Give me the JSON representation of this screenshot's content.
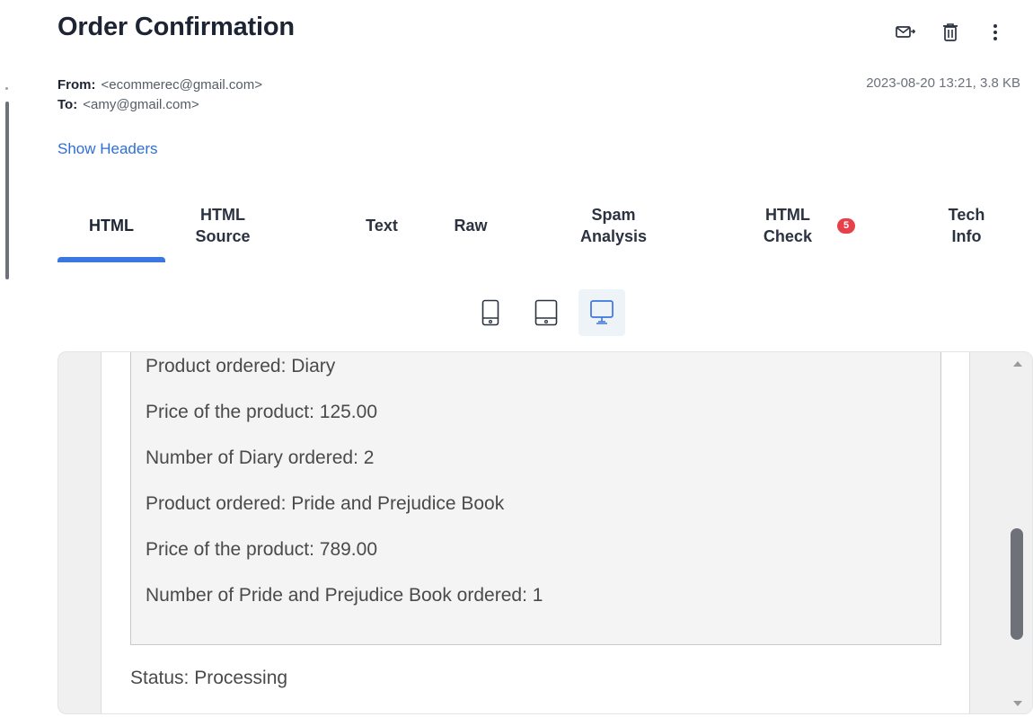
{
  "email": {
    "subject": "Order Confirmation",
    "from_label": "From:",
    "from_value": "<ecommerec@gmail.com>",
    "to_label": "To:",
    "to_value": "<amy@gmail.com>",
    "date_size": "2023-08-20 13:21, 3.8 KB",
    "show_headers": "Show Headers"
  },
  "actions": {
    "forward_icon": "envelope-forward-icon",
    "delete_icon": "trash-icon",
    "more_icon": "more-vertical-icon"
  },
  "tabs": [
    {
      "label": "HTML",
      "active": true
    },
    {
      "label_line1": "HTML",
      "label_line2": "Source"
    },
    {
      "label": "Text"
    },
    {
      "label": "Raw"
    },
    {
      "label_line1": "Spam",
      "label_line2": "Analysis"
    },
    {
      "label_line1": "HTML",
      "label_line2": "Check",
      "badge": "5"
    },
    {
      "label_line1": "Tech",
      "label_line2": "Info"
    }
  ],
  "devices": [
    "mobile-icon",
    "tablet-icon",
    "desktop-icon"
  ],
  "preview": {
    "lines": [
      "Product ordered: Diary",
      "Price of the product: 125.00",
      "Number of Diary ordered: 2",
      "Product ordered: Pride and Prejudice Book",
      "Price of the product: 789.00",
      "Number of Pride and Prejudice Book ordered: 1"
    ],
    "status": "Status: Processing"
  },
  "colors": {
    "accent": "#3b76e1",
    "link": "#2e6fd6",
    "badge": "#e8404a"
  }
}
